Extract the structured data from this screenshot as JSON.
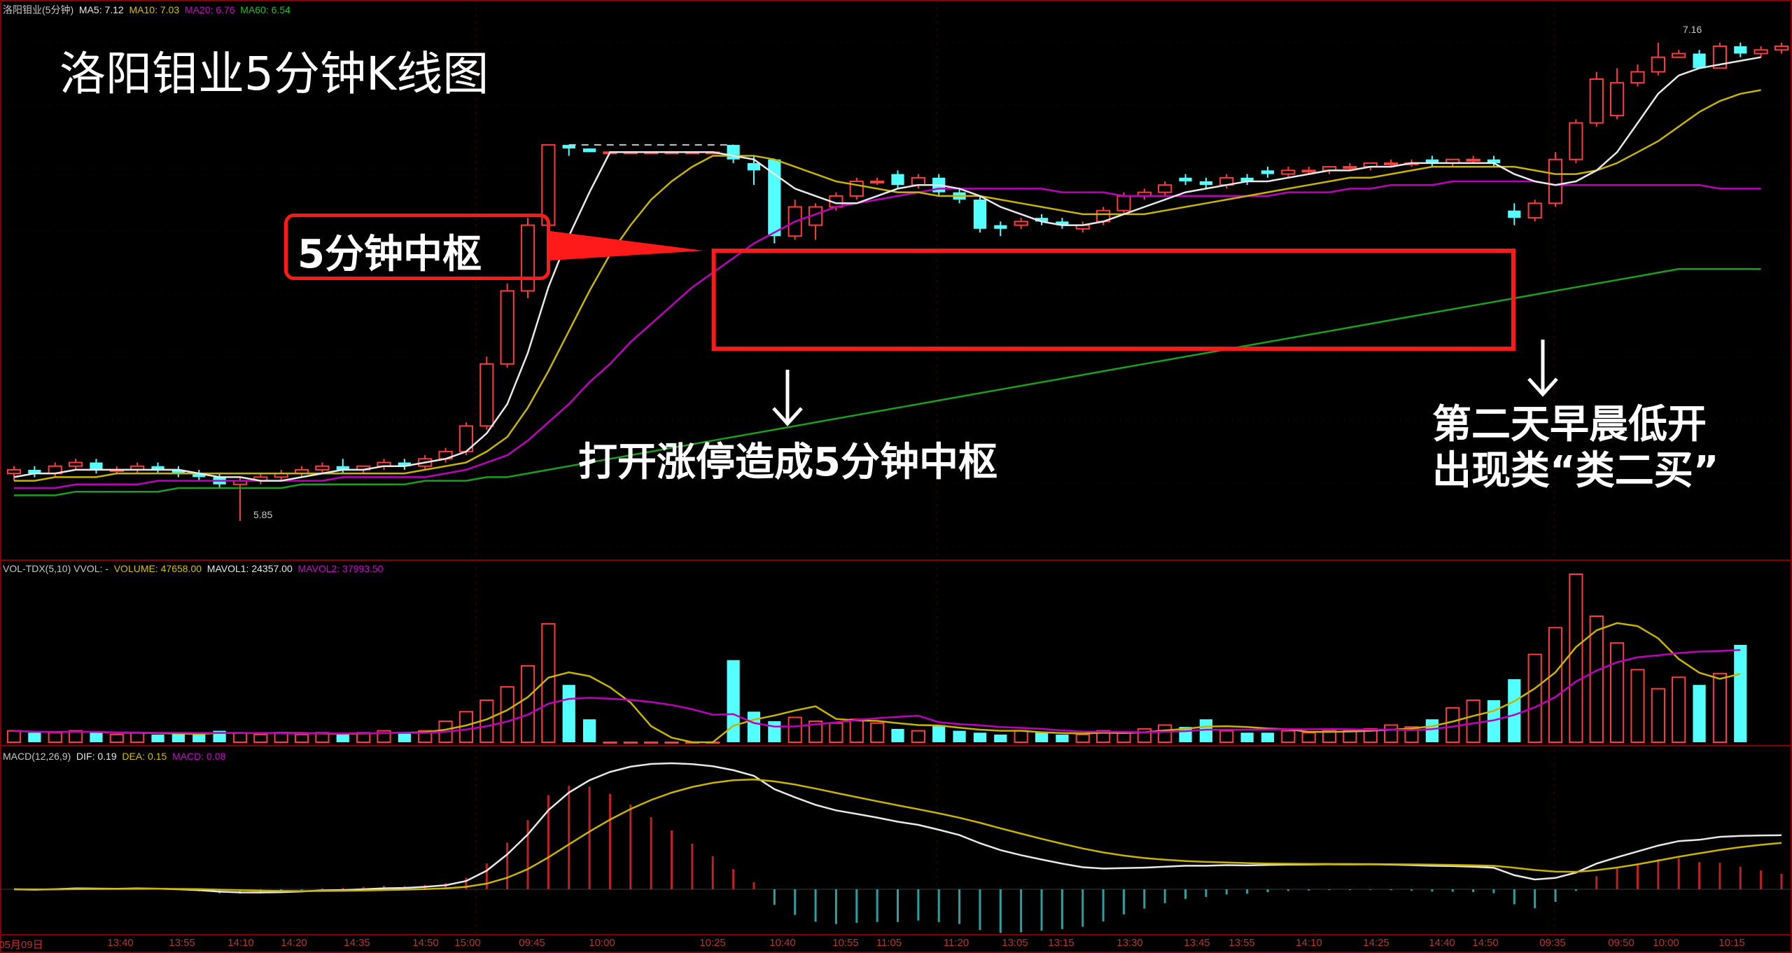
{
  "stock_label": "洛阳钼业(5分钟)",
  "title": "洛阳钼业5分钟K线图",
  "colors": {
    "background": "#000000",
    "up": "#ff3b3b",
    "down": "#54ffff",
    "grid": "#5a0000",
    "ma5": "#e8e8e8",
    "ma10": "#c8b400",
    "ma20": "#c000c0",
    "ma60": "#1aa01a",
    "box": "#ff1a1a"
  },
  "price_panel": {
    "ma5_label": "MA5: 7.12",
    "ma10_label": "MA10: 7.03",
    "ma20_label": "MA20: 6.76",
    "ma60_label": "MA60: 6.54",
    "low_label": "5.85",
    "high_label": "7.16"
  },
  "volume_panel": {
    "name": "VOL-TDX(5,10) VVOL: -",
    "volume_label": "VOLUME: 47658.00",
    "mavol1_label": "MAVOL1: 24357.00",
    "mavol2_label": "MAVOL2: 37993.50"
  },
  "macd_panel": {
    "name": "MACD(12,26,9)",
    "dif_label": "DIF: 0.19",
    "dea_label": "DEA: 0.15",
    "macd_label": "MACD: 0.08"
  },
  "annotations": {
    "zhongshu_box_label": "5分钟中枢",
    "middle_text": "打开涨停造成5分钟中枢",
    "right_line1": "第二天早晨低开",
    "right_line2": "出现类“类二买”"
  },
  "time_ticks": [
    "05月09日",
    "13:40",
    "13:55",
    "14:10",
    "14:20",
    "14:35",
    "14:50",
    "15:00",
    "09:45",
    "10:00",
    "10:25",
    "10:40",
    "10:55",
    "11:05",
    "11:20",
    "13:05",
    "13:15",
    "13:30",
    "13:45",
    "13:55",
    "14:10",
    "14:25",
    "14:40",
    "14:50",
    "09:35",
    "09:50",
    "10:00",
    "10:15"
  ],
  "chart_data": {
    "type": "candlestick",
    "ohlc": [
      [
        5.98,
        6.0,
        5.96,
        5.99
      ],
      [
        5.99,
        6.0,
        5.97,
        5.98
      ],
      [
        5.98,
        6.01,
        5.97,
        6.0
      ],
      [
        6.0,
        6.02,
        5.99,
        6.01
      ],
      [
        6.01,
        6.02,
        5.98,
        5.99
      ],
      [
        5.99,
        6.0,
        5.98,
        5.99
      ],
      [
        5.99,
        6.01,
        5.98,
        6.0
      ],
      [
        6.0,
        6.01,
        5.98,
        5.99
      ],
      [
        5.99,
        6.0,
        5.97,
        5.98
      ],
      [
        5.98,
        5.99,
        5.96,
        5.97
      ],
      [
        5.97,
        5.98,
        5.94,
        5.95
      ],
      [
        5.95,
        5.97,
        5.85,
        5.96
      ],
      [
        5.96,
        5.98,
        5.95,
        5.97
      ],
      [
        5.97,
        5.99,
        5.96,
        5.98
      ],
      [
        5.98,
        6.0,
        5.97,
        5.99
      ],
      [
        5.99,
        6.01,
        5.98,
        6.0
      ],
      [
        6.0,
        6.02,
        5.98,
        5.99
      ],
      [
        5.99,
        6.0,
        5.98,
        6.0
      ],
      [
        6.0,
        6.02,
        5.99,
        6.01
      ],
      [
        6.01,
        6.02,
        5.99,
        6.0
      ],
      [
        6.0,
        6.03,
        5.99,
        6.02
      ],
      [
        6.02,
        6.05,
        6.01,
        6.04
      ],
      [
        6.04,
        6.12,
        6.03,
        6.11
      ],
      [
        6.11,
        6.3,
        6.1,
        6.28
      ],
      [
        6.28,
        6.5,
        6.27,
        6.48
      ],
      [
        6.48,
        6.68,
        6.46,
        6.66
      ],
      [
        6.66,
        6.88,
        6.65,
        6.88
      ],
      [
        6.88,
        6.88,
        6.85,
        6.87
      ],
      [
        6.87,
        6.87,
        6.86,
        6.86
      ],
      [
        6.86,
        6.86,
        6.86,
        6.86
      ],
      [
        6.86,
        6.86,
        6.86,
        6.86
      ],
      [
        6.86,
        6.86,
        6.86,
        6.86
      ],
      [
        6.86,
        6.86,
        6.86,
        6.86
      ],
      [
        6.86,
        6.86,
        6.86,
        6.86
      ],
      [
        6.86,
        6.86,
        6.86,
        6.86
      ],
      [
        6.88,
        6.88,
        6.83,
        6.84
      ],
      [
        6.83,
        6.85,
        6.77,
        6.81
      ],
      [
        6.84,
        6.84,
        6.61,
        6.63
      ],
      [
        6.63,
        6.73,
        6.62,
        6.71
      ],
      [
        6.66,
        6.72,
        6.62,
        6.71
      ],
      [
        6.71,
        6.75,
        6.7,
        6.74
      ],
      [
        6.74,
        6.79,
        6.73,
        6.78
      ],
      [
        6.78,
        6.79,
        6.77,
        6.78
      ],
      [
        6.8,
        6.81,
        6.76,
        6.77
      ],
      [
        6.77,
        6.8,
        6.76,
        6.79
      ],
      [
        6.79,
        6.8,
        6.74,
        6.75
      ],
      [
        6.75,
        6.76,
        6.72,
        6.73
      ],
      [
        6.73,
        6.74,
        6.64,
        6.65
      ],
      [
        6.66,
        6.67,
        6.63,
        6.65
      ],
      [
        6.66,
        6.68,
        6.65,
        6.67
      ],
      [
        6.68,
        6.69,
        6.66,
        6.67
      ],
      [
        6.67,
        6.68,
        6.65,
        6.66
      ],
      [
        6.65,
        6.67,
        6.64,
        6.66
      ],
      [
        6.67,
        6.71,
        6.66,
        6.7
      ],
      [
        6.7,
        6.75,
        6.69,
        6.74
      ],
      [
        6.74,
        6.76,
        6.73,
        6.75
      ],
      [
        6.75,
        6.78,
        6.74,
        6.77
      ],
      [
        6.79,
        6.8,
        6.77,
        6.78
      ],
      [
        6.78,
        6.79,
        6.76,
        6.77
      ],
      [
        6.77,
        6.8,
        6.76,
        6.79
      ],
      [
        6.79,
        6.8,
        6.77,
        6.78
      ],
      [
        6.81,
        6.82,
        6.79,
        6.8
      ],
      [
        6.8,
        6.82,
        6.79,
        6.81
      ],
      [
        6.81,
        6.82,
        6.8,
        6.81
      ],
      [
        6.81,
        6.82,
        6.8,
        6.82
      ],
      [
        6.82,
        6.83,
        6.81,
        6.82
      ],
      [
        6.82,
        6.83,
        6.81,
        6.83
      ],
      [
        6.83,
        6.84,
        6.82,
        6.83
      ],
      [
        6.83,
        6.84,
        6.82,
        6.83
      ],
      [
        6.84,
        6.85,
        6.82,
        6.83
      ],
      [
        6.83,
        6.84,
        6.82,
        6.84
      ],
      [
        6.84,
        6.85,
        6.83,
        6.84
      ],
      [
        6.84,
        6.85,
        6.82,
        6.83
      ],
      [
        6.7,
        6.72,
        6.66,
        6.68
      ],
      [
        6.68,
        6.73,
        6.67,
        6.72
      ],
      [
        6.72,
        6.86,
        6.71,
        6.84
      ],
      [
        6.84,
        6.95,
        6.83,
        6.94
      ],
      [
        6.94,
        7.08,
        6.93,
        7.06
      ],
      [
        6.96,
        7.09,
        6.95,
        7.05
      ],
      [
        7.05,
        7.1,
        7.04,
        7.08
      ],
      [
        7.08,
        7.16,
        7.07,
        7.12
      ],
      [
        7.12,
        7.14,
        7.12,
        7.13
      ],
      [
        7.13,
        7.14,
        7.09,
        7.09
      ],
      [
        7.09,
        7.16,
        7.09,
        7.15
      ],
      [
        7.15,
        7.16,
        7.12,
        7.13
      ],
      [
        7.13,
        7.15,
        7.12,
        7.14
      ],
      [
        7.14,
        7.16,
        7.13,
        7.15
      ]
    ],
    "volume": [
      6,
      5,
      5,
      6,
      5,
      4,
      5,
      4,
      5,
      4,
      6,
      5,
      4,
      5,
      4,
      5,
      4,
      5,
      6,
      5,
      6,
      11,
      16,
      22,
      29,
      40,
      62,
      30,
      12,
      0,
      0,
      0,
      0,
      0,
      0,
      43,
      16,
      11,
      13,
      11,
      10,
      12,
      10,
      7,
      6,
      9,
      6,
      5,
      4,
      6,
      5,
      4,
      4,
      6,
      5,
      7,
      9,
      8,
      12,
      6,
      5,
      5,
      6,
      5,
      6,
      6,
      7,
      9,
      8,
      12,
      18,
      22,
      22,
      33,
      46,
      60,
      88,
      66,
      52,
      38,
      28,
      34,
      30,
      36,
      51
    ],
    "ma5": [
      5.97,
      5.98,
      5.98,
      5.99,
      5.99,
      5.99,
      5.99,
      5.99,
      5.99,
      5.98,
      5.97,
      5.97,
      5.96,
      5.96,
      5.97,
      5.98,
      5.99,
      5.99,
      6.0,
      6.0,
      6.01,
      6.02,
      6.04,
      6.09,
      6.17,
      6.31,
      6.49,
      6.63,
      6.75,
      6.86,
      6.86,
      6.86,
      6.86,
      6.86,
      6.86,
      6.85,
      6.84,
      6.8,
      6.76,
      6.74,
      6.72,
      6.72,
      6.74,
      6.76,
      6.77,
      6.77,
      6.76,
      6.74,
      6.71,
      6.69,
      6.67,
      6.66,
      6.66,
      6.67,
      6.69,
      6.71,
      6.73,
      6.75,
      6.76,
      6.77,
      6.78,
      6.78,
      6.79,
      6.8,
      6.81,
      6.81,
      6.82,
      6.82,
      6.83,
      6.83,
      6.83,
      6.83,
      6.83,
      6.8,
      6.78,
      6.77,
      6.78,
      6.81,
      6.86,
      6.94,
      7.02,
      7.07,
      7.09,
      7.1,
      7.11,
      7.12
    ],
    "ma10": [
      5.96,
      5.96,
      5.97,
      5.97,
      5.97,
      5.98,
      5.98,
      5.98,
      5.98,
      5.98,
      5.98,
      5.98,
      5.98,
      5.98,
      5.98,
      5.98,
      5.98,
      5.98,
      5.98,
      5.98,
      5.99,
      6.0,
      6.01,
      6.04,
      6.08,
      6.16,
      6.26,
      6.37,
      6.48,
      6.58,
      6.66,
      6.73,
      6.78,
      6.82,
      6.85,
      6.85,
      6.85,
      6.84,
      6.82,
      6.8,
      6.78,
      6.77,
      6.76,
      6.75,
      6.75,
      6.74,
      6.74,
      6.74,
      6.73,
      6.72,
      6.71,
      6.7,
      6.69,
      6.69,
      6.69,
      6.69,
      6.7,
      6.71,
      6.72,
      6.73,
      6.74,
      6.75,
      6.76,
      6.77,
      6.78,
      6.79,
      6.79,
      6.8,
      6.81,
      6.82,
      6.82,
      6.82,
      6.82,
      6.82,
      6.81,
      6.8,
      6.8,
      6.81,
      6.83,
      6.86,
      6.89,
      6.93,
      6.97,
      7.0,
      7.02,
      7.03
    ],
    "ma20": [
      5.94,
      5.94,
      5.94,
      5.95,
      5.95,
      5.95,
      5.95,
      5.96,
      5.96,
      5.96,
      5.96,
      5.96,
      5.96,
      5.96,
      5.96,
      5.96,
      5.97,
      5.97,
      5.97,
      5.97,
      5.97,
      5.98,
      5.99,
      6.01,
      6.03,
      6.07,
      6.12,
      6.17,
      6.23,
      6.28,
      6.34,
      6.39,
      6.44,
      6.49,
      6.53,
      6.57,
      6.61,
      6.64,
      6.67,
      6.69,
      6.71,
      6.72,
      6.73,
      6.74,
      6.75,
      6.76,
      6.76,
      6.76,
      6.76,
      6.76,
      6.76,
      6.75,
      6.75,
      6.75,
      6.74,
      6.74,
      6.74,
      6.74,
      6.74,
      6.74,
      6.74,
      6.74,
      6.75,
      6.75,
      6.75,
      6.76,
      6.76,
      6.77,
      6.77,
      6.77,
      6.78,
      6.78,
      6.78,
      6.78,
      6.78,
      6.77,
      6.77,
      6.77,
      6.77,
      6.77,
      6.77,
      6.77,
      6.77,
      6.76,
      6.76,
      6.76
    ],
    "ma60": [
      5.92,
      5.92,
      5.92,
      5.93,
      5.93,
      5.93,
      5.93,
      5.93,
      5.94,
      5.94,
      5.94,
      5.94,
      5.94,
      5.94,
      5.95,
      5.95,
      5.95,
      5.95,
      5.95,
      5.95,
      5.96,
      5.96,
      5.96,
      5.97,
      5.97,
      5.98,
      5.99,
      6.0,
      6.01,
      6.02,
      6.03,
      6.04,
      6.05,
      6.06,
      6.07,
      6.08,
      6.09,
      6.1,
      6.11,
      6.12,
      6.13,
      6.14,
      6.15,
      6.16,
      6.17,
      6.18,
      6.19,
      6.2,
      6.21,
      6.22,
      6.23,
      6.24,
      6.25,
      6.26,
      6.27,
      6.28,
      6.29,
      6.3,
      6.31,
      6.32,
      6.33,
      6.34,
      6.35,
      6.36,
      6.37,
      6.38,
      6.39,
      6.4,
      6.41,
      6.42,
      6.43,
      6.44,
      6.45,
      6.46,
      6.47,
      6.48,
      6.49,
      6.5,
      6.51,
      6.52,
      6.53,
      6.54,
      6.54,
      6.54,
      6.54,
      6.54
    ],
    "ylim": [
      5.8,
      7.2
    ],
    "highlight_range": [
      35,
      72
    ]
  }
}
